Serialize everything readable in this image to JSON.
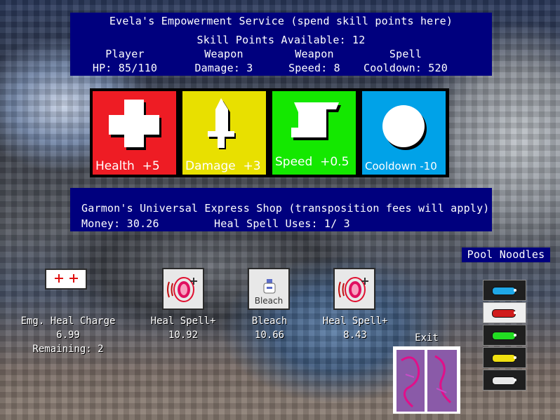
{
  "empower": {
    "title": "Evela's Empowerment Service (spend skill points here)",
    "skill_points": "Skill Points Available: 12",
    "stats": [
      {
        "label": "Player",
        "value": "HP: 85/110"
      },
      {
        "label": "Weapon",
        "value": "Damage: 3"
      },
      {
        "label": "Weapon",
        "value": "Speed: 8"
      },
      {
        "label": "Spell",
        "value": "Cooldown: 520"
      }
    ]
  },
  "skills": [
    {
      "label": "Health  +5",
      "color": "#ee1c24",
      "icon": "health-cross-icon"
    },
    {
      "label": "Damage  +3",
      "color": "#e8e000",
      "icon": "sword-icon"
    },
    {
      "label": "Speed  +0.5",
      "color": "#14e800",
      "icon": "scroll-icon"
    },
    {
      "label": "Cooldown -10",
      "color": "#00a2e8",
      "icon": "circle-icon"
    }
  ],
  "shop": {
    "title": "Garmon's Universal Express Shop (transposition fees will apply)",
    "money": "Money: 30.26",
    "heal_uses": "Heal Spell Uses: 1/ 3"
  },
  "items": [
    {
      "name": "Emg. Heal Charge",
      "price": "6.99",
      "extra": "Remaining: 2",
      "icon": "emergency-heal-icon"
    },
    {
      "name": "Heal Spell+",
      "price": "10.92",
      "icon": "heal-spell-icon"
    },
    {
      "name": "Bleach",
      "price": "10.66",
      "icon": "bleach-bottle-icon",
      "icon_label": "Bleach"
    },
    {
      "name": "Heal Spell+",
      "price": "8.43",
      "icon": "heal-spell-icon"
    }
  ],
  "exit": {
    "label": "Exit",
    "icon": "exit-door-icon"
  },
  "pool_noodles": {
    "title": "Pool Noodles",
    "colors": [
      {
        "name": "blue",
        "hex": "#1fa8e8",
        "bg": "#1f1f1f"
      },
      {
        "name": "red",
        "hex": "#d01c1c",
        "bg": "#eeeeee"
      },
      {
        "name": "green",
        "hex": "#22dd22",
        "bg": "#1f1f1f"
      },
      {
        "name": "yellow",
        "hex": "#f0e010",
        "bg": "#1f1f1f"
      },
      {
        "name": "white",
        "hex": "#e8e8e8",
        "bg": "#1f1f1f"
      }
    ]
  }
}
